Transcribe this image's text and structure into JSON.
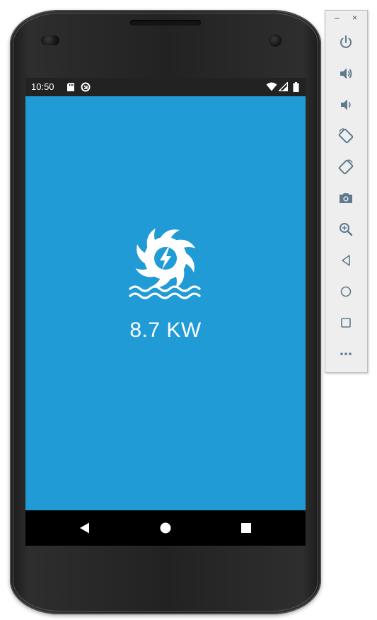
{
  "status_bar": {
    "time": "10:50"
  },
  "app": {
    "power_reading": "8.7 KW",
    "icon": "water-turbine-icon",
    "background_color": "#209bd5"
  },
  "navigation": {
    "back": "back-icon",
    "home": "home-icon",
    "recents": "recents-icon"
  },
  "emulator_toolbar": {
    "minimize_label": "–",
    "close_label": "×",
    "buttons": [
      "power-icon",
      "volume-up-icon",
      "volume-down-icon",
      "rotate-left-icon",
      "rotate-right-icon",
      "camera-icon",
      "zoom-icon",
      "back-icon",
      "home-icon",
      "overview-icon",
      "more-icon"
    ],
    "icon_color": "#5f7a8c"
  }
}
